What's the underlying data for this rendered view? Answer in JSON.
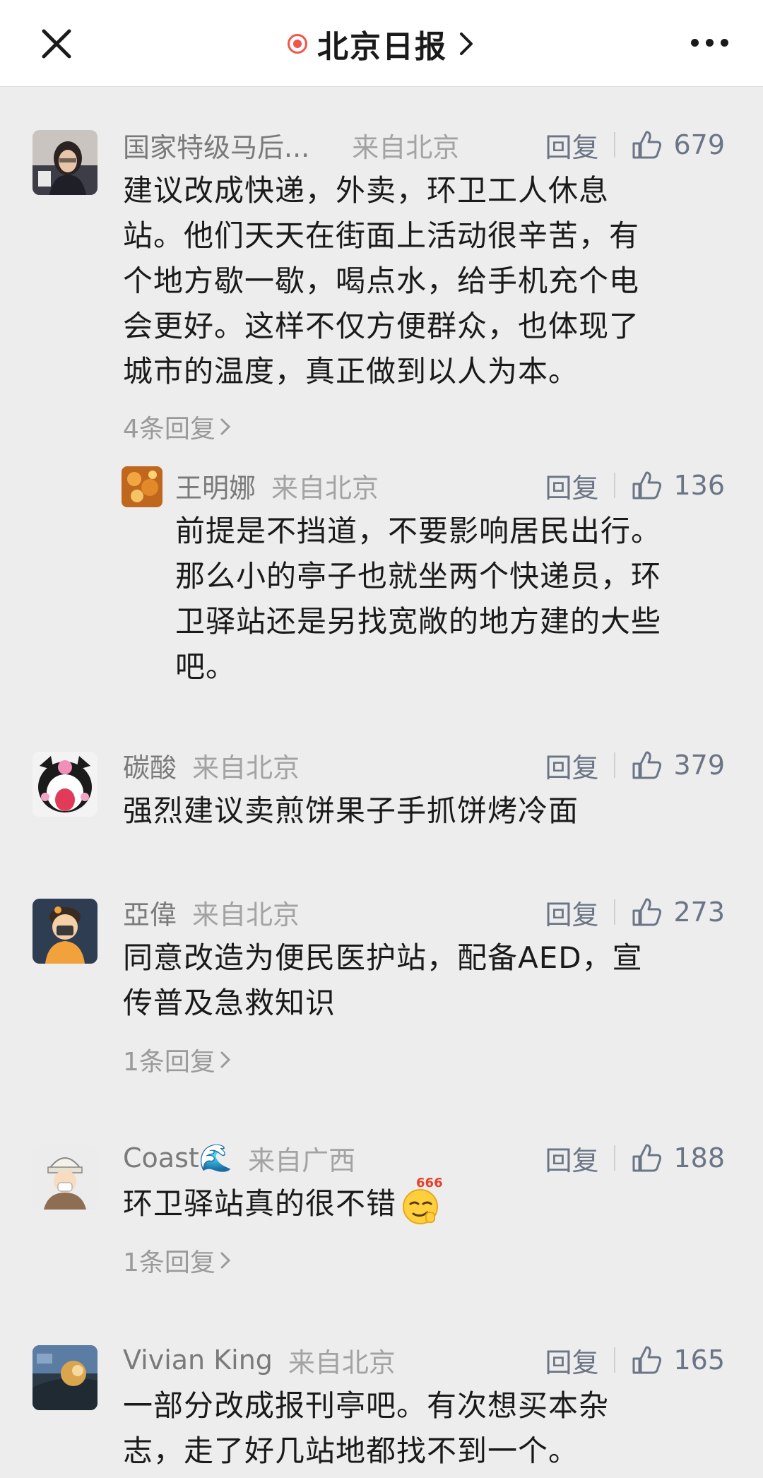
{
  "header": {
    "title": "北京日报"
  },
  "comments": [
    {
      "username": "国家特级马后...",
      "location": "来自北京",
      "reply_label": "回复",
      "likes": "679",
      "lines": [
        "建议改成快递，外卖，环卫工人休息",
        "站。他们天天在街面上活动很辛苦，有",
        "个地方歇一歇，喝点水，给手机充个电",
        "会更好。这样不仅方便群众，也体现了",
        "城市的温度，真正做到以人为本。"
      ],
      "reply_count": "4条回复",
      "sub": {
        "username": "王明娜",
        "location": "来自北京",
        "reply_label": "回复",
        "likes": "136",
        "lines": [
          "前提是不挡道，不要影响居民出行。",
          "那么小的亭子也就坐两个快递员，环",
          "卫驿站还是另找宽敞的地方建的大些",
          "吧。"
        ]
      }
    },
    {
      "username": "碳酸",
      "location": "来自北京",
      "reply_label": "回复",
      "likes": "379",
      "lines": [
        "强烈建议卖煎饼果子手抓饼烤冷面"
      ]
    },
    {
      "username": "亞偉",
      "location": "来自北京",
      "reply_label": "回复",
      "likes": "273",
      "lines": [
        "同意改造为便民医护站，配备AED，宣",
        "传普及急救知识"
      ],
      "reply_count": "1条回复"
    },
    {
      "username": "Coast🌊",
      "location": "来自广西",
      "reply_label": "回复",
      "likes": "188",
      "lines": [
        "环卫驿站真的很不错"
      ],
      "emoji_badge": "666",
      "reply_count": "1条回复"
    },
    {
      "username": "Vivian King",
      "location": "来自北京",
      "reply_label": "回复",
      "likes": "165",
      "lines": [
        "一部分改成报刊亭吧。有次想买本杂",
        "志，走了好几站地都找不到一个。"
      ]
    }
  ],
  "colors": {
    "accent_red": "#f0574b",
    "action_gray_blue": "#6b7586",
    "background": "#ededed"
  },
  "icons": [
    "close-icon",
    "live-dot-icon",
    "chevron-right-icon",
    "more-icon",
    "thumbs-up-icon",
    "smirk-emoji-icon"
  ]
}
